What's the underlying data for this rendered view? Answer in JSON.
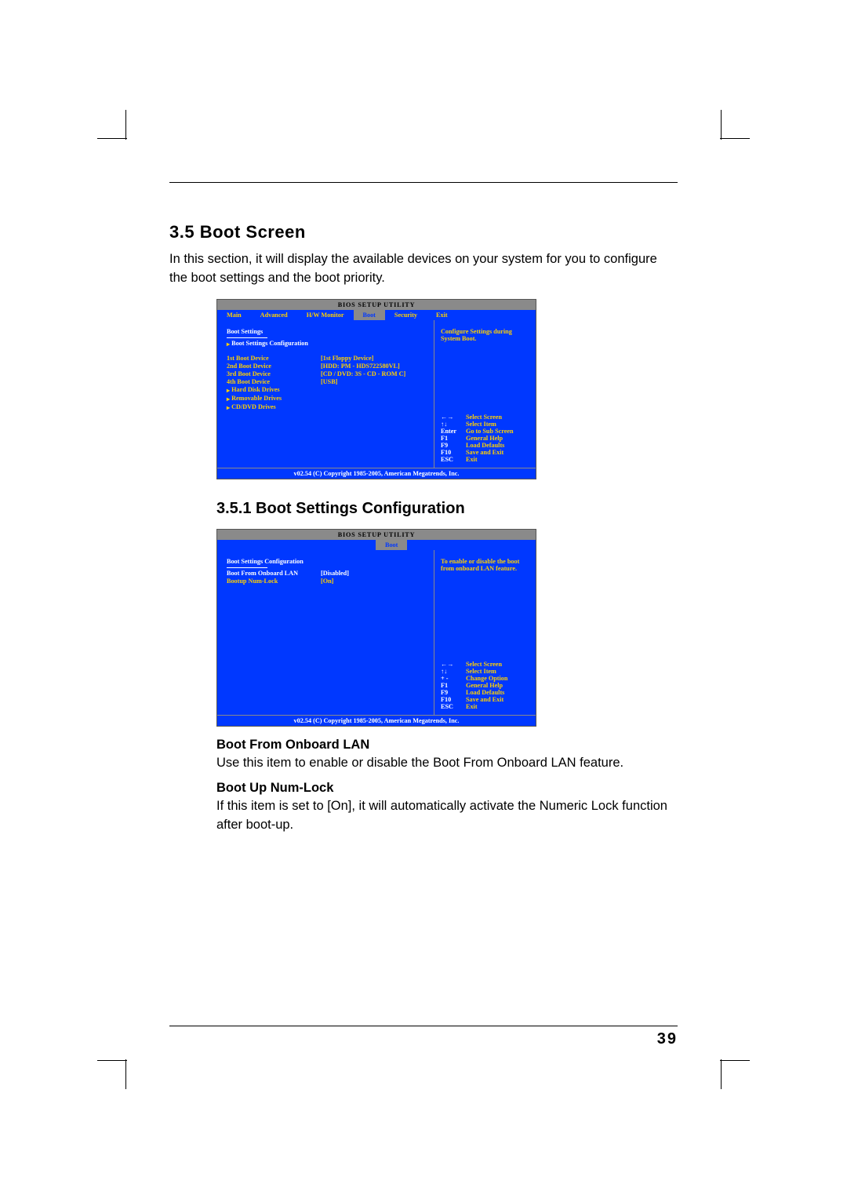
{
  "page_number": "39",
  "section_title": "3.5 Boot Screen",
  "section_intro": "In this section, it will display the available devices on your system for you to configure the boot settings and the boot priority.",
  "subsection_title": "3.5.1 Boot Settings Configuration",
  "opt1_heading": "Boot From Onboard LAN",
  "opt1_desc": "Use this item to enable or disable the Boot From Onboard LAN feature.",
  "opt2_heading": "Boot Up Num-Lock",
  "opt2_desc": "If this item is set to [On], it will automatically activate the Numeric Lock function after boot-up.",
  "bios1": {
    "title": "BIOS SETUP UTILITY",
    "tabs": [
      "Main",
      "Advanced",
      "H/W Monitor",
      "Boot",
      "Security",
      "Exit"
    ],
    "section": "Boot Settings",
    "sub_config": "Boot Settings Configuration",
    "rows": [
      {
        "k": "1st Boot Device",
        "v": "[1st  Floppy Device]"
      },
      {
        "k": "2nd Boot Device",
        "v": "[HDD: PM - HDS722580VL]"
      },
      {
        "k": "3rd Boot Device",
        "v": "[CD / DVD: 3S - CD - ROM C]"
      },
      {
        "k": "4th Boot Device",
        "v": "[USB]"
      }
    ],
    "subs": [
      "Hard Disk Drives",
      "Removable Drives",
      "CD/DVD Drives"
    ],
    "help_top": "Configure Settings during System Boot.",
    "help_keys": [
      {
        "k": "←→",
        "v": "Select Screen"
      },
      {
        "k": "↑↓",
        "v": "Select Item"
      },
      {
        "k": "Enter",
        "v": "Go to Sub Screen"
      },
      {
        "k": "F1",
        "v": "General Help"
      },
      {
        "k": "F9",
        "v": "Load Defaults"
      },
      {
        "k": "F10",
        "v": "Save and Exit"
      },
      {
        "k": "ESC",
        "v": "Exit"
      }
    ],
    "footer": "v02.54 (C) Copyright 1985-2005, American Megatrends, Inc."
  },
  "bios2": {
    "title": "BIOS SETUP UTILITY",
    "tab": "Boot",
    "section": "Boot Settings Configuration",
    "rows": [
      {
        "k": "Boot From Onboard LAN",
        "v": "[Disabled]",
        "sel": true
      },
      {
        "k": "Bootup Num-Lock",
        "v": "[On]"
      }
    ],
    "help_top": "To enable or disable the boot from onboard LAN feature.",
    "help_keys": [
      {
        "k": "←→",
        "v": "Select Screen"
      },
      {
        "k": "↑↓",
        "v": "Select Item"
      },
      {
        "k": "+ -",
        "v": "Change Option"
      },
      {
        "k": "F1",
        "v": "General Help"
      },
      {
        "k": "F9",
        "v": "Load Defaults"
      },
      {
        "k": "F10",
        "v": "Save and Exit"
      },
      {
        "k": "ESC",
        "v": "Exit"
      }
    ],
    "footer": "v02.54 (C) Copyright 1985-2005, American Megatrends, Inc."
  }
}
